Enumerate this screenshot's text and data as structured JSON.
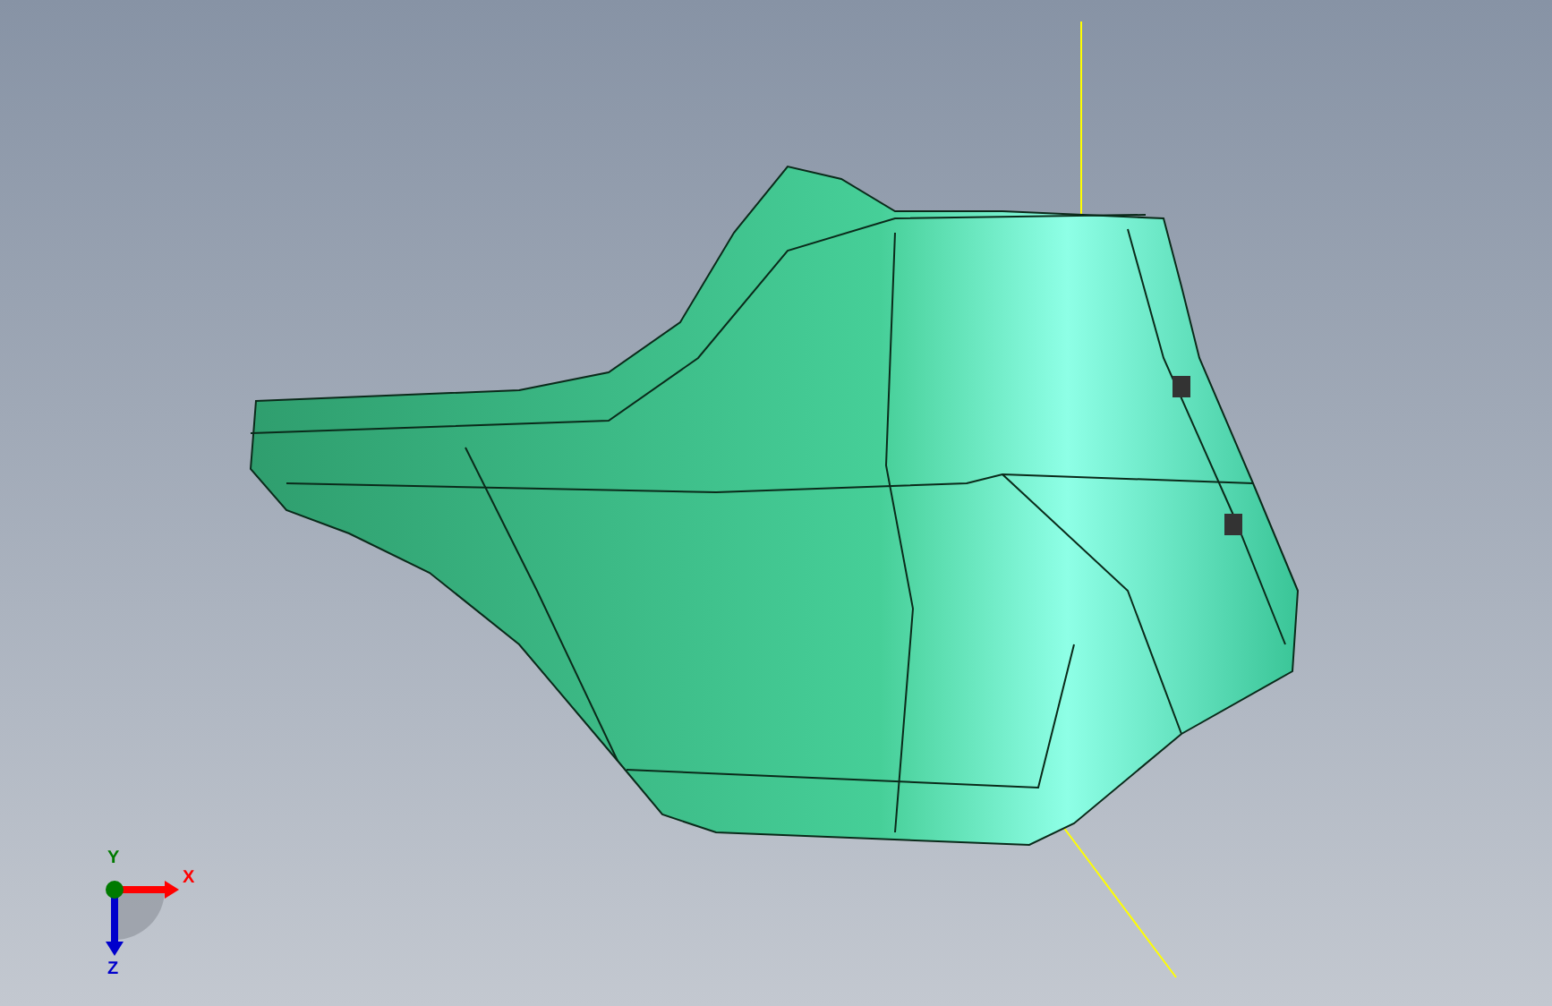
{
  "triad": {
    "axes": [
      {
        "label": "X",
        "color": "#ff0000"
      },
      {
        "label": "Y",
        "color": "#007a00"
      },
      {
        "label": "Z",
        "color": "#0000cc"
      }
    ]
  }
}
